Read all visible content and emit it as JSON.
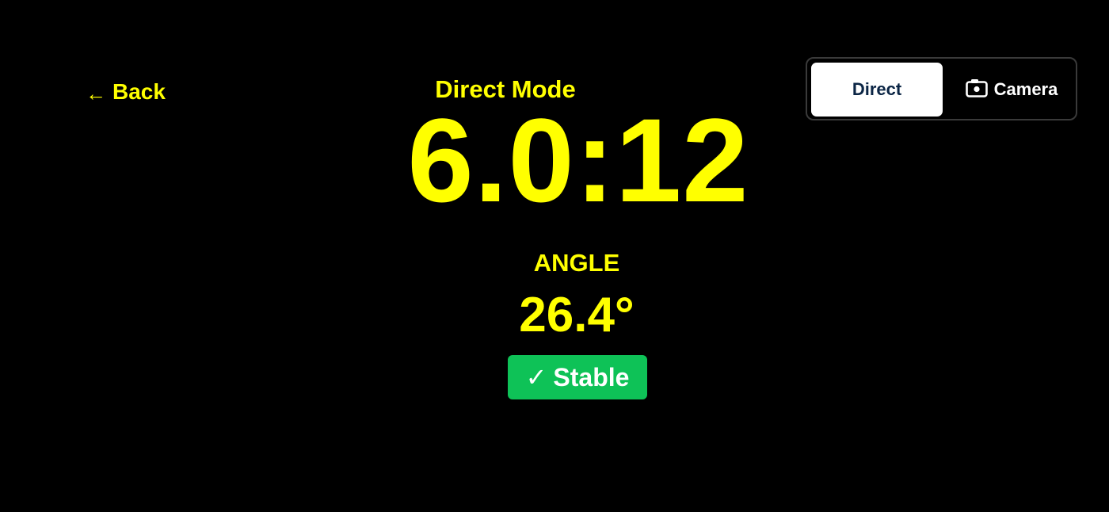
{
  "header": {
    "back_arrow": "←",
    "back_label": "Back",
    "mode_title": "Direct Mode"
  },
  "readout": {
    "main_value": "6.0:12"
  },
  "angle": {
    "label": "ANGLE",
    "value": "26.4°"
  },
  "status": {
    "check": "✓",
    "label": "Stable",
    "color": "#0EC257"
  },
  "mode_toggle": {
    "direct_label": "Direct",
    "camera_label": "Camera",
    "camera_icon": "camera-icon",
    "selected": "Direct"
  },
  "colors": {
    "background": "#000000",
    "accent": "#FFFF00",
    "toggle_active_text": "#0B2545"
  }
}
